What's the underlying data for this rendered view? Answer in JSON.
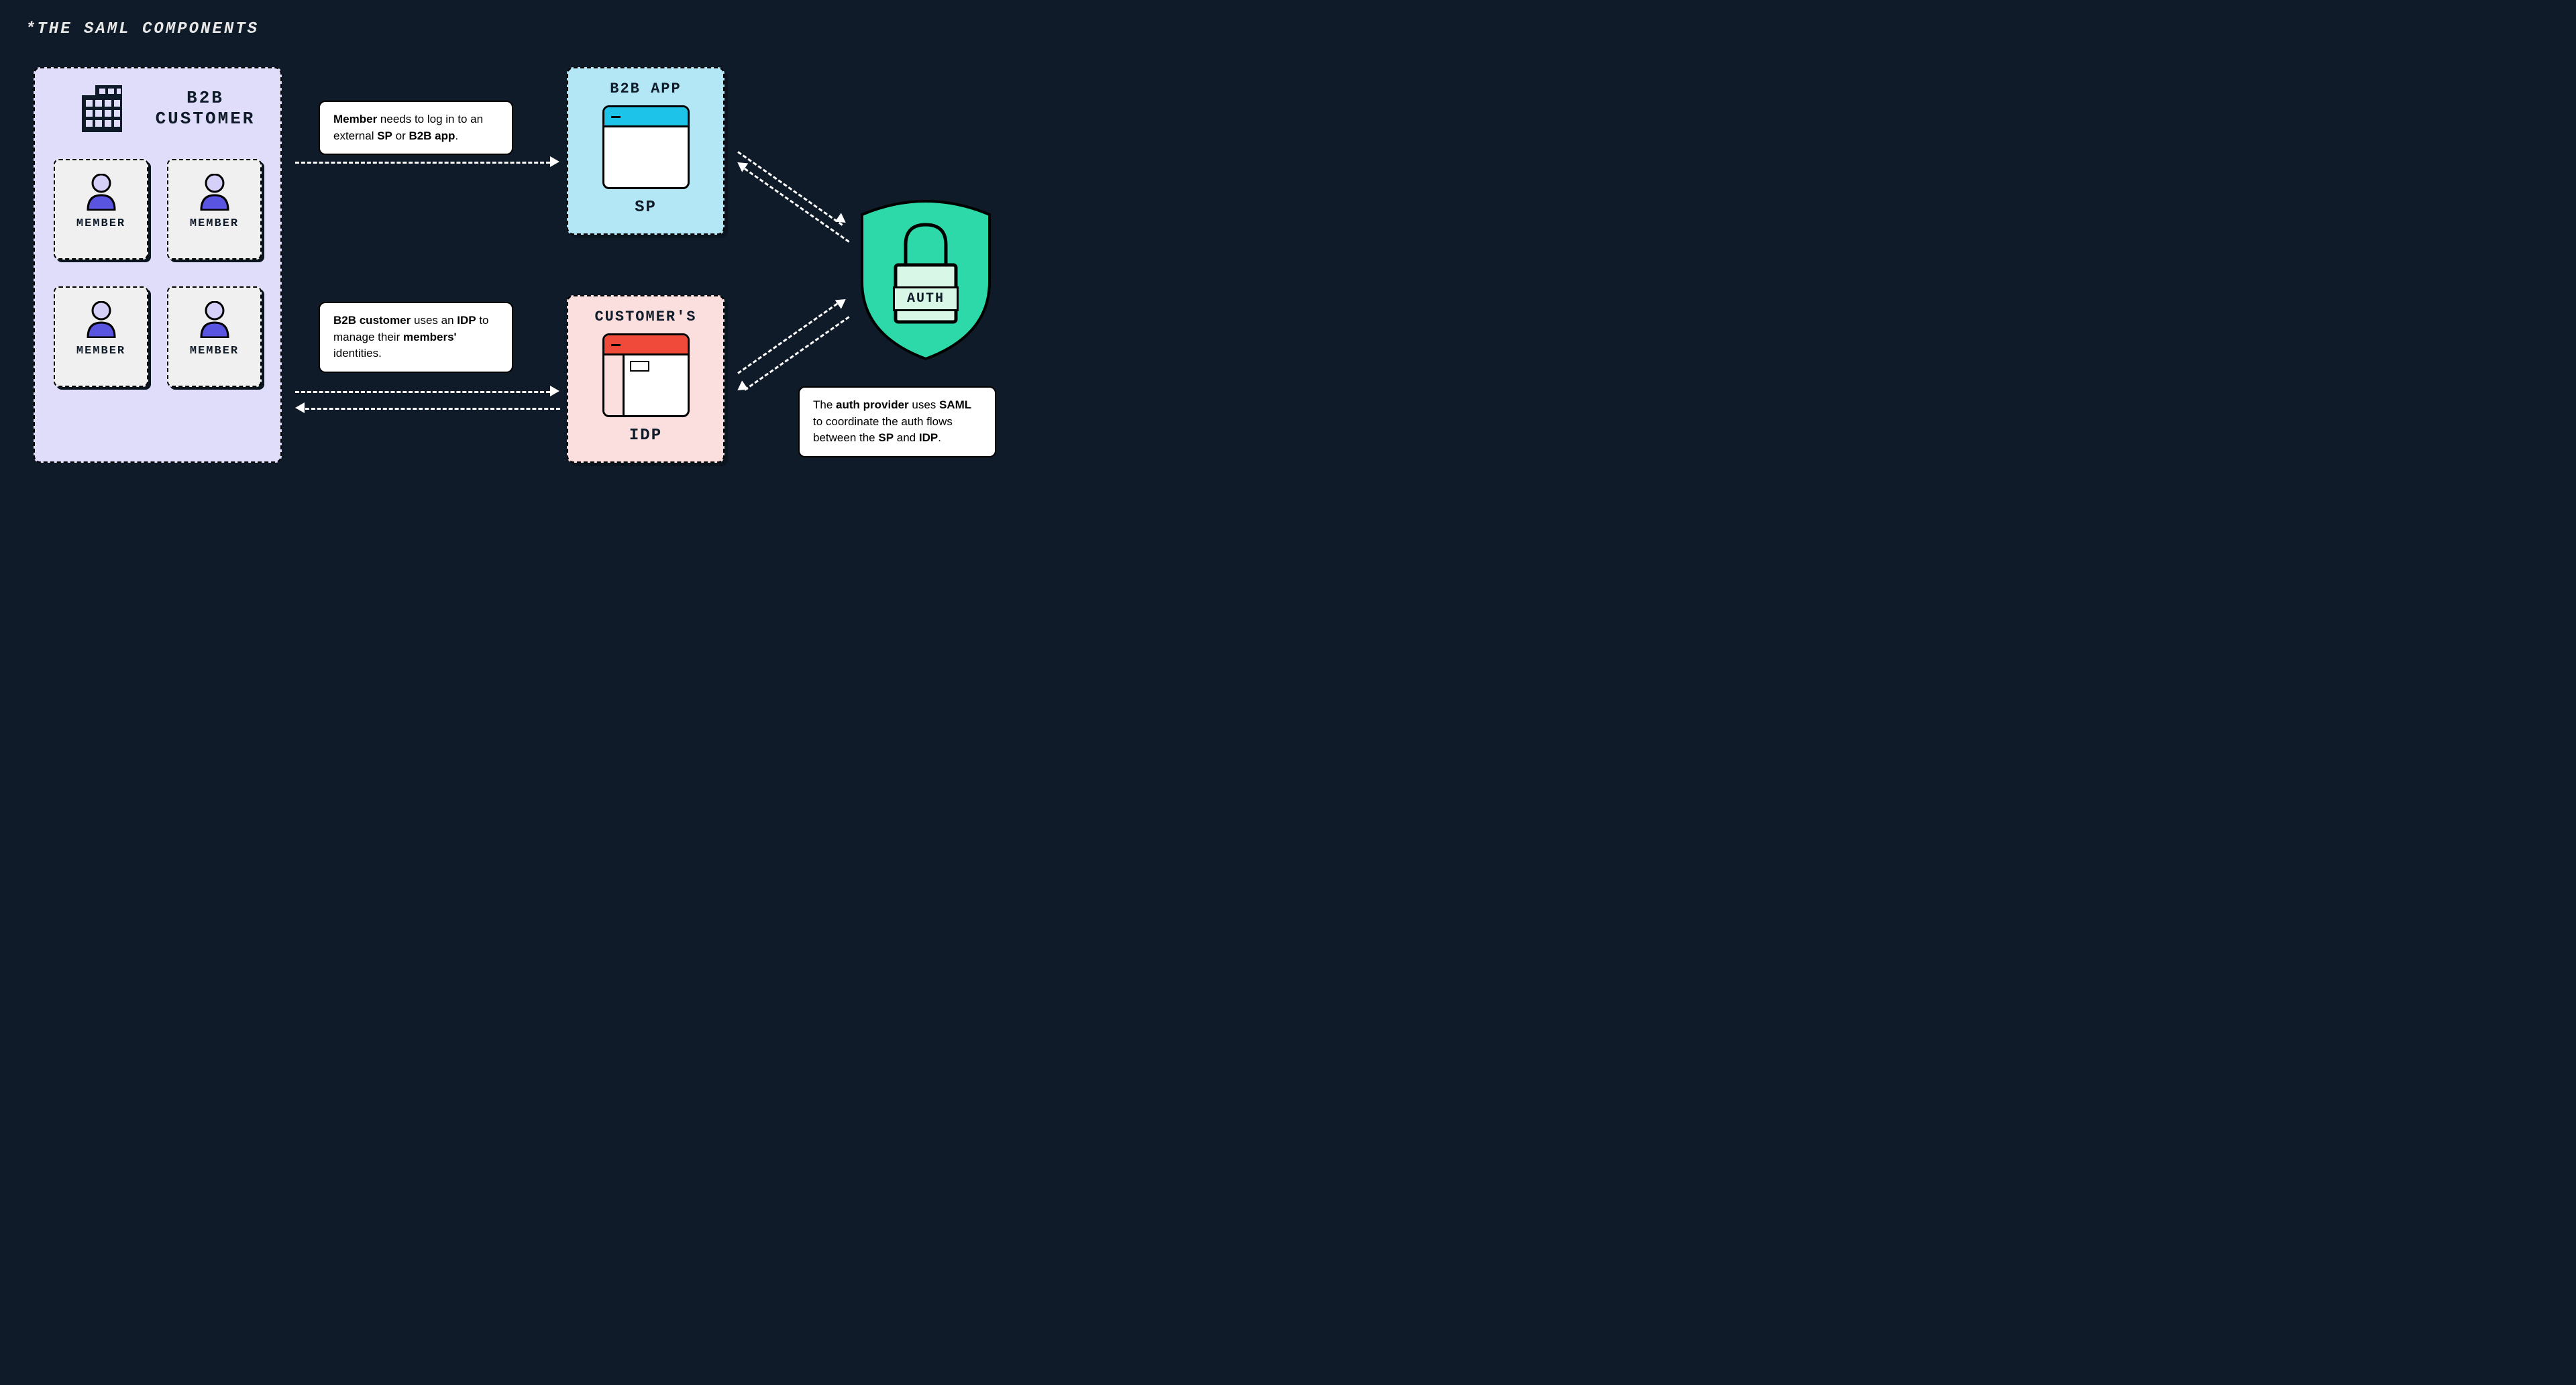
{
  "title": "*THE SAML COMPONENTS",
  "customer": {
    "title": "B2B CUSTOMER",
    "member_label": "MEMBER"
  },
  "callouts": {
    "c1": "<b>Member</b> needs to log in to an external <b>SP</b> or <b>B2B app</b>.",
    "c2": "<b>B2B customer</b> uses an <b>IDP</b> to manage their <b>members'</b> identities.",
    "c3": "The <b>auth provider</b> uses <b>SAML</b> to coordinate the auth flows between the <b>SP</b> and <b>IDP</b>."
  },
  "sp_panel": {
    "title": "B2B APP",
    "sub": "SP"
  },
  "idp_panel": {
    "title": "CUSTOMER'S",
    "sub": "IDP"
  },
  "auth": {
    "label": "AUTH"
  }
}
